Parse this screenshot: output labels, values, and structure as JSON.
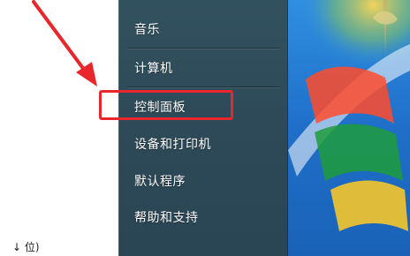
{
  "start_menu": {
    "items": [
      {
        "label": "音乐"
      },
      {
        "label": "计算机"
      },
      {
        "label": "控制面板"
      },
      {
        "label": "设备和打印机"
      },
      {
        "label": "默认程序"
      },
      {
        "label": "帮助和支持"
      }
    ],
    "highlighted_item": "控制面板"
  },
  "left_pane": {
    "partial_text": "↓ 位)"
  },
  "colors": {
    "highlight_border": "#e8262c",
    "arrow": "#e8262c",
    "menu_background": "#2e4a58"
  },
  "icons": [
    "annotation-arrow",
    "windows-wallpaper"
  ]
}
